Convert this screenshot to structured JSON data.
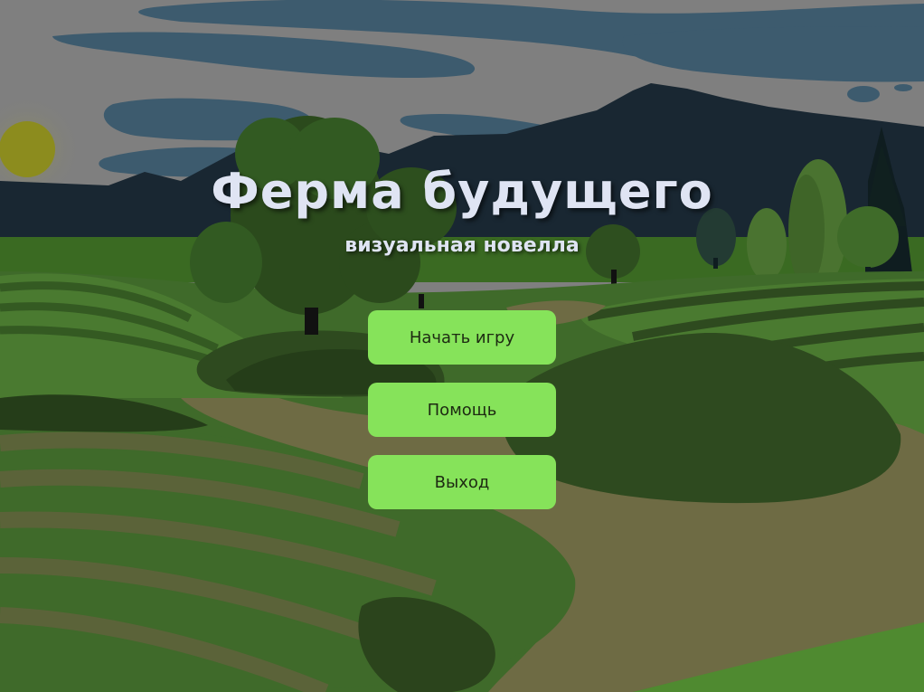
{
  "game": {
    "title": "Ферма будущего",
    "subtitle": "визуальная новелла"
  },
  "menu": {
    "buttons": [
      {
        "label": "Начать игру"
      },
      {
        "label": "Помощь"
      },
      {
        "label": "Выход"
      }
    ]
  },
  "colors": {
    "sky": "#7f7f7f",
    "cloud": "#3d5b6e",
    "mountain": "#192732",
    "sun": "#8c8c1e",
    "field_dark": "#2e4a1f",
    "field_mid": "#3f6a2a",
    "field_light": "#537a33",
    "path": "#6e6b44",
    "button": "#86e35a",
    "title_text": "#dfe4f3"
  }
}
